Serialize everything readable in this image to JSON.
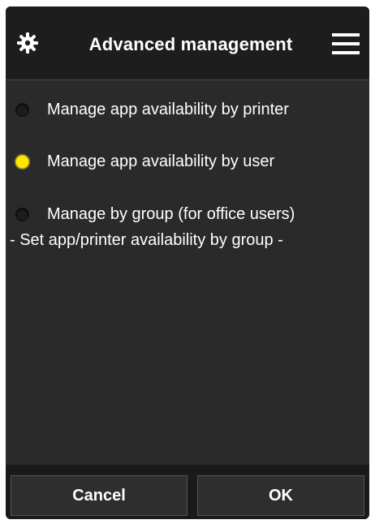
{
  "header": {
    "title": "Advanced management",
    "left_icon": "gear-icon",
    "right_icon": "hamburger-menu-icon"
  },
  "options": [
    {
      "label": "Manage app availability by printer",
      "selected": false
    },
    {
      "label": "Manage app availability by user",
      "selected": true
    },
    {
      "label": "Manage by group (for office users)",
      "selected": false
    }
  ],
  "group_option_description": "- Set app/printer availability by group -",
  "footer": {
    "cancel_label": "Cancel",
    "ok_label": "OK"
  },
  "colors": {
    "background": "#2a2a2a",
    "header": "#1d1d1d",
    "selected_radio": "#ffe600",
    "text": "#ffffff"
  }
}
